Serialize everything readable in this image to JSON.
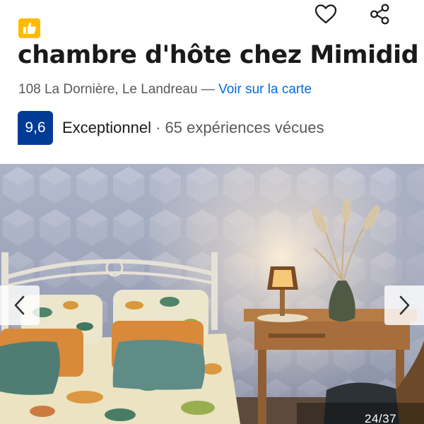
{
  "header": {
    "badge_icon": "thumbs-up-icon",
    "badge_color": "#febb02",
    "favorite_icon": "heart-icon",
    "share_icon": "share-icon"
  },
  "property": {
    "name": "chambre d'hôte chez Mimidid",
    "address": "108 La Dornière, Le Landreau",
    "separator": " — ",
    "map_link_label": "Voir sur la carte"
  },
  "rating": {
    "score": "9,6",
    "label": "Exceptionnel",
    "separator": " · ",
    "reviews": "65 expériences vécues",
    "badge_color": "#003b95"
  },
  "gallery": {
    "counter": "24/37",
    "prev_icon": "chevron-left-icon",
    "next_icon": "chevron-right-icon"
  },
  "colors": {
    "link": "#006ce4",
    "text": "#1a1a1a",
    "muted": "#595959"
  }
}
